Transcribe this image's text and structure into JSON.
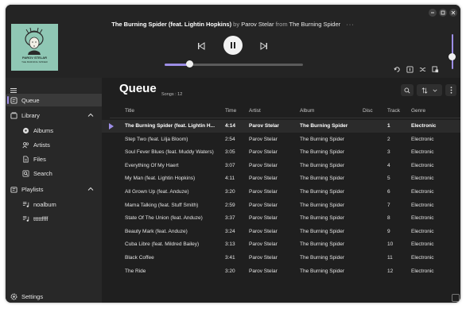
{
  "header": {
    "title": "The Burning Spider (feat. Lightin Hopkins)",
    "by": "by",
    "artist": "Parov Stelar",
    "from": "from",
    "album": "The Burning Spider",
    "more": "···"
  },
  "album_art": {
    "label1": "PAROV STELAR",
    "label2": "THE BURNING SPIDER"
  },
  "player": {
    "progress": 0.18,
    "volume": 0.3
  },
  "sidebar": {
    "queue": "Queue",
    "library": "Library",
    "albums": "Albums",
    "artists": "Artists",
    "files": "Files",
    "search": "Search",
    "playlists": "Playlists",
    "playlist1": "noalbum",
    "playlist2": "tttttffff",
    "settings": "Settings"
  },
  "queue": {
    "title": "Queue",
    "songs_label": "Songs :  12",
    "columns": {
      "title": "Title",
      "time": "Time",
      "artist": "Artist",
      "album": "Album",
      "disc": "Disc",
      "track": "Track",
      "genre": "Genre"
    },
    "rows": [
      {
        "title": "The Burning Spider (feat. Lightin H...",
        "time": "4:14",
        "artist": "Parov Stelar",
        "album": "The Burning Spider",
        "track": "1",
        "genre": "Electronic"
      },
      {
        "title": "Step Two (feat. Lilja Bloom)",
        "time": "2:54",
        "artist": "Parov Stelar",
        "album": "The Burning Spider",
        "track": "2",
        "genre": "Electronic"
      },
      {
        "title": "Soul Fever Blues (feat. Muddy Waters)",
        "time": "3:05",
        "artist": "Parov Stelar",
        "album": "The Burning Spider",
        "track": "3",
        "genre": "Electronic"
      },
      {
        "title": "Everything Of My Haert",
        "time": "3:07",
        "artist": "Parov Stelar",
        "album": "The Burning Spider",
        "track": "4",
        "genre": "Electronic"
      },
      {
        "title": "My Man (feat. Lightin Hopkins)",
        "time": "4:11",
        "artist": "Parov Stelar",
        "album": "The Burning Spider",
        "track": "5",
        "genre": "Electronic"
      },
      {
        "title": "All Grown Up (feat. Anduze)",
        "time": "3:20",
        "artist": "Parov Stelar",
        "album": "The Burning Spider",
        "track": "6",
        "genre": "Electronic"
      },
      {
        "title": "Mama Talking (feat. Stuff Smith)",
        "time": "2:59",
        "artist": "Parov Stelar",
        "album": "The Burning Spider",
        "track": "7",
        "genre": "Electronic"
      },
      {
        "title": "State Of The Union (feat. Anduze)",
        "time": "3:37",
        "artist": "Parov Stelar",
        "album": "The Burning Spider",
        "track": "8",
        "genre": "Electronic"
      },
      {
        "title": "Beauty Mark (feat. Anduze)",
        "time": "3:24",
        "artist": "Parov Stelar",
        "album": "The Burning Spider",
        "track": "9",
        "genre": "Electronic"
      },
      {
        "title": "Cuba Libre (feat. Mildred Bailey)",
        "time": "3:13",
        "artist": "Parov Stelar",
        "album": "The Burning Spider",
        "track": "10",
        "genre": "Electronic"
      },
      {
        "title": "Black Coffee",
        "time": "3:41",
        "artist": "Parov Stelar",
        "album": "The Burning Spider",
        "track": "11",
        "genre": "Electronic"
      },
      {
        "title": "The Ride",
        "time": "3:20",
        "artist": "Parov Stelar",
        "album": "The Burning Spider",
        "track": "12",
        "genre": "Electronic"
      }
    ]
  }
}
